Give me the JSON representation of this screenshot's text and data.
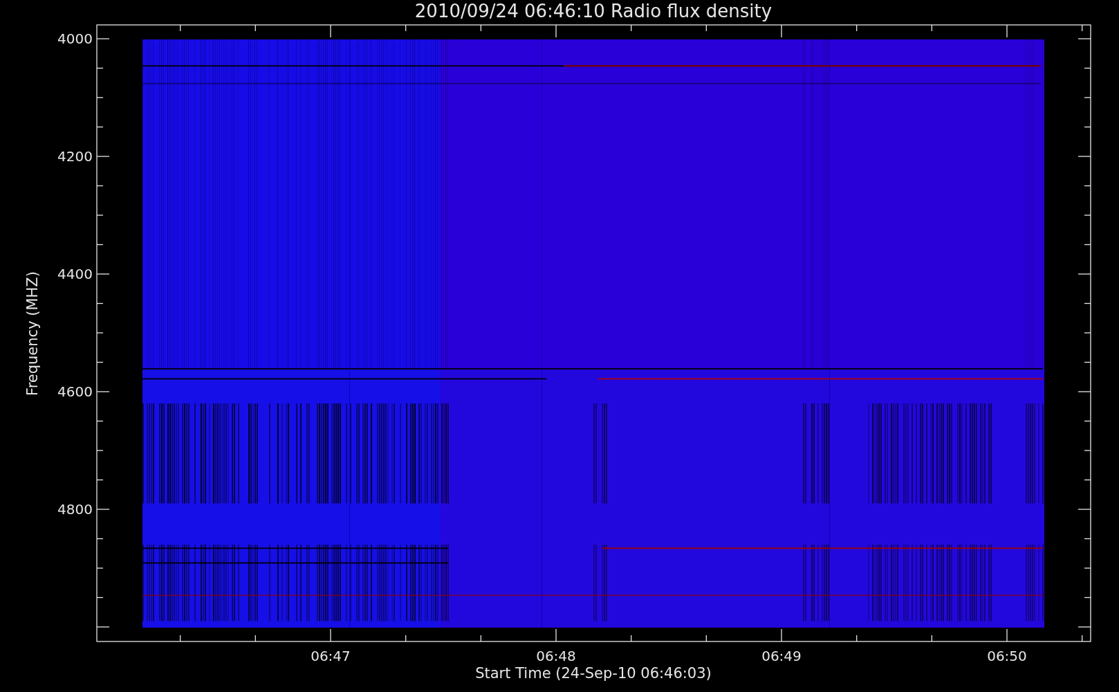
{
  "title": "2010/09/24 06:46:10 Radio flux density",
  "y_axis": {
    "label": "Frequency (MHZ)",
    "ticks": [
      "4000",
      "4200",
      "4400",
      "4600",
      "4800"
    ]
  },
  "x_axis": {
    "label": "Start Time (24-Sep-10 06:46:03)",
    "ticks": [
      "06:47",
      "06:48",
      "06:49",
      "06:50"
    ]
  }
}
